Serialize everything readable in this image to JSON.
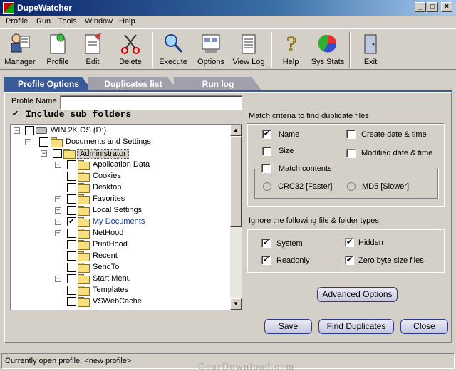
{
  "window": {
    "title": "DupeWatcher"
  },
  "menu": [
    "Profile",
    "Run",
    "Tools",
    "Window",
    "Help"
  ],
  "toolbar": {
    "manager": "Manager",
    "profile": "Profile",
    "edit": "Edit",
    "delete": "Delete",
    "execute": "Execute",
    "options": "Options",
    "view_log": "View Log",
    "help": "Help",
    "sys_stats": "Sys Stats",
    "exit": "Exit"
  },
  "tabs": {
    "profile_options": "Profile Options",
    "duplicates_list": "Duplicates list",
    "run_log": "Run log"
  },
  "profile": {
    "name_label": "Profile Name",
    "name_value": "",
    "include_sub_folders": "Include sub folders",
    "include_sub_folders_checked": true
  },
  "tree": {
    "root": "WIN 2K OS (D:)",
    "docs": "Documents and Settings",
    "admin": "Administrator",
    "items": [
      {
        "label": "Application Data",
        "expandable": true,
        "checked": false
      },
      {
        "label": "Cookies",
        "expandable": false,
        "checked": false
      },
      {
        "label": "Desktop",
        "expandable": false,
        "checked": false
      },
      {
        "label": "Favorites",
        "expandable": true,
        "checked": false
      },
      {
        "label": "Local Settings",
        "expandable": true,
        "checked": false
      },
      {
        "label": "My Documents",
        "expandable": true,
        "checked": true
      },
      {
        "label": "NetHood",
        "expandable": true,
        "checked": false
      },
      {
        "label": "PrintHood",
        "expandable": false,
        "checked": false
      },
      {
        "label": "Recent",
        "expandable": false,
        "checked": false
      },
      {
        "label": "SendTo",
        "expandable": false,
        "checked": false
      },
      {
        "label": "Start Menu",
        "expandable": true,
        "checked": false
      },
      {
        "label": "Templates",
        "expandable": false,
        "checked": false
      },
      {
        "label": "VSWebCache",
        "expandable": false,
        "checked": false
      }
    ]
  },
  "match": {
    "heading": "Match criteria to find duplicate files",
    "name": "Name",
    "name_checked": true,
    "size": "Size",
    "size_checked": false,
    "create_date": "Create date & time",
    "create_checked": false,
    "modified_date": "Modified date & time",
    "modified_checked": false,
    "contents": "Match contents",
    "contents_checked": false,
    "crc32": "CRC32 [Faster]",
    "md5": "MD5 [Slower]"
  },
  "ignore": {
    "heading": "Ignore the following file & folder types",
    "system": "System",
    "system_checked": true,
    "hidden": "Hidden",
    "hidden_checked": true,
    "readonly": "Readonly",
    "readonly_checked": true,
    "zero_byte": "Zero byte size files",
    "zero_checked": true
  },
  "buttons": {
    "advanced": "Advanced Options",
    "save": "Save",
    "find": "Find Duplicates",
    "close": "Close"
  },
  "status": {
    "text": "Currently open profile: <new profile>"
  },
  "watermark": "GearDownload.com"
}
